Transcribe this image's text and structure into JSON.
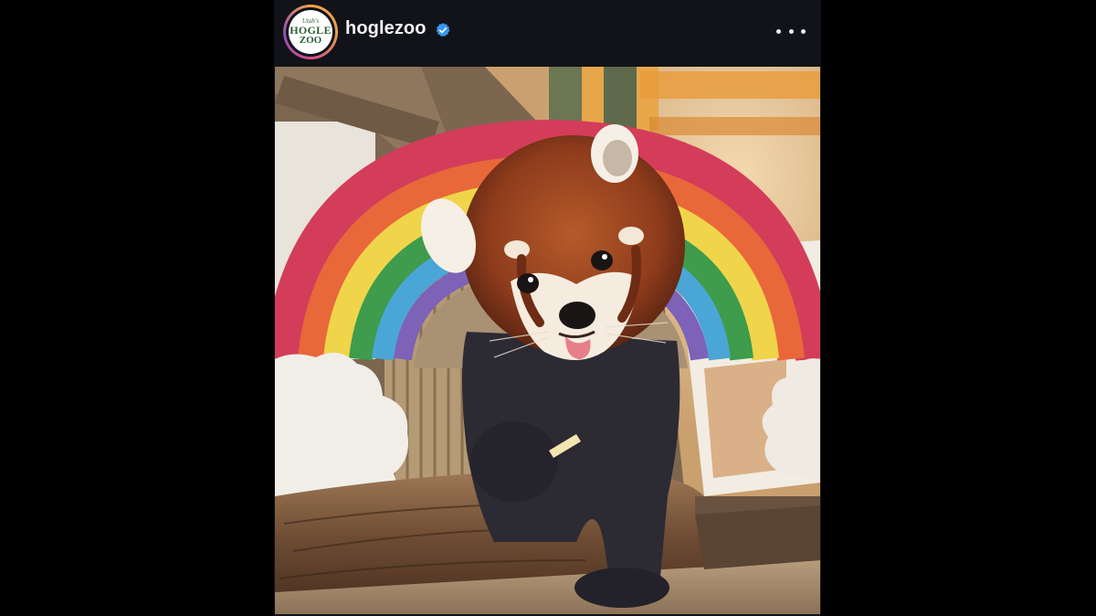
{
  "post": {
    "author": {
      "username": "hoglezoo",
      "verified": true,
      "avatar_logo": {
        "line1": "Utah's",
        "line2": "HOGLE",
        "line3": "ZOO"
      }
    },
    "menu_icon": "more-horizontal-icon",
    "image": {
      "subject": "red-panda-with-rainbow"
    }
  },
  "colors": {
    "background": "#000000",
    "header_bg": "#111318",
    "username": "#f2f2f2",
    "verified_badge": "#3897f0",
    "logo_green": "#2c5e2e"
  }
}
